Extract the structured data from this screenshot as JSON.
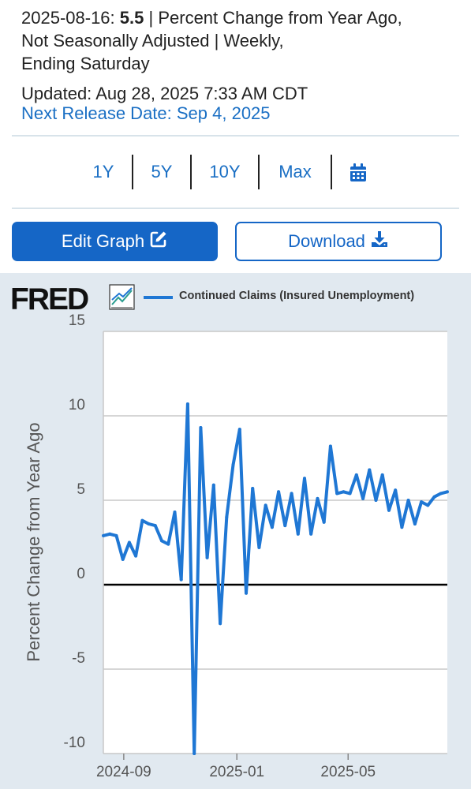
{
  "header": {
    "date": "2025-08-16:",
    "value": "5.5",
    "units_line": "| Percent Change from Year Ago,",
    "line2": "Not Seasonally Adjusted | Weekly,",
    "line3": "Ending Saturday",
    "updated": "Updated: Aug 28, 2025 7:33 AM CDT",
    "next_release": "Next Release Date: Sep 4, 2025"
  },
  "ranges": [
    "1Y",
    "5Y",
    "10Y",
    "Max"
  ],
  "buttons": {
    "edit": "Edit Graph",
    "download": "Download"
  },
  "logo": "FRED",
  "colors": {
    "accent": "#1566c6",
    "line": "#1f77d4",
    "chart_bg": "#e1e9f0"
  },
  "chart_data": {
    "type": "line",
    "title": "",
    "xlabel": "",
    "ylabel": "Percent Change from Year Ago",
    "ylim": [
      -10,
      15
    ],
    "yticks": [
      15,
      10,
      5,
      0,
      -5,
      -10
    ],
    "xlim": [
      "2024-08-10",
      "2025-08-16"
    ],
    "xticks": [
      {
        "date": "2024-09-01",
        "label": "2024-09"
      },
      {
        "date": "2025-01-01",
        "label": "2025-01"
      },
      {
        "date": "2025-05-01",
        "label": "2025-05"
      }
    ],
    "grid": true,
    "legend": "top",
    "series": [
      {
        "name": "Continued Claims (Insured Unemployment)",
        "x": [
          "2024-08-10",
          "2024-08-17",
          "2024-08-24",
          "2024-08-31",
          "2024-09-07",
          "2024-09-14",
          "2024-09-21",
          "2024-09-28",
          "2024-10-05",
          "2024-10-12",
          "2024-10-19",
          "2024-10-26",
          "2024-11-02",
          "2024-11-09",
          "2024-11-16",
          "2024-11-23",
          "2024-11-30",
          "2024-12-07",
          "2024-12-14",
          "2024-12-21",
          "2024-12-28",
          "2025-01-04",
          "2025-01-11",
          "2025-01-18",
          "2025-01-25",
          "2025-02-01",
          "2025-02-08",
          "2025-02-15",
          "2025-02-22",
          "2025-03-01",
          "2025-03-08",
          "2025-03-15",
          "2025-03-22",
          "2025-03-29",
          "2025-04-05",
          "2025-04-12",
          "2025-04-19",
          "2025-04-26",
          "2025-05-03",
          "2025-05-10",
          "2025-05-17",
          "2025-05-24",
          "2025-05-31",
          "2025-06-07",
          "2025-06-14",
          "2025-06-21",
          "2025-06-28",
          "2025-07-05",
          "2025-07-12",
          "2025-07-19",
          "2025-07-26",
          "2025-08-02",
          "2025-08-09",
          "2025-08-16"
        ],
        "values": [
          2.9,
          3.0,
          2.9,
          1.5,
          2.5,
          1.7,
          3.8,
          3.6,
          3.5,
          2.6,
          2.4,
          4.3,
          0.3,
          10.7,
          -10.0,
          9.3,
          1.6,
          5.9,
          -2.3,
          4.0,
          7.1,
          9.2,
          -0.5,
          5.7,
          2.2,
          4.7,
          3.4,
          5.5,
          3.5,
          5.4,
          3.0,
          6.3,
          3.0,
          5.1,
          3.7,
          8.2,
          5.4,
          5.5,
          5.4,
          6.5,
          5.1,
          6.8,
          5.0,
          6.5,
          4.4,
          5.6,
          3.4,
          5.0,
          3.6,
          4.9,
          4.7,
          5.2,
          5.4,
          5.5
        ]
      }
    ]
  }
}
